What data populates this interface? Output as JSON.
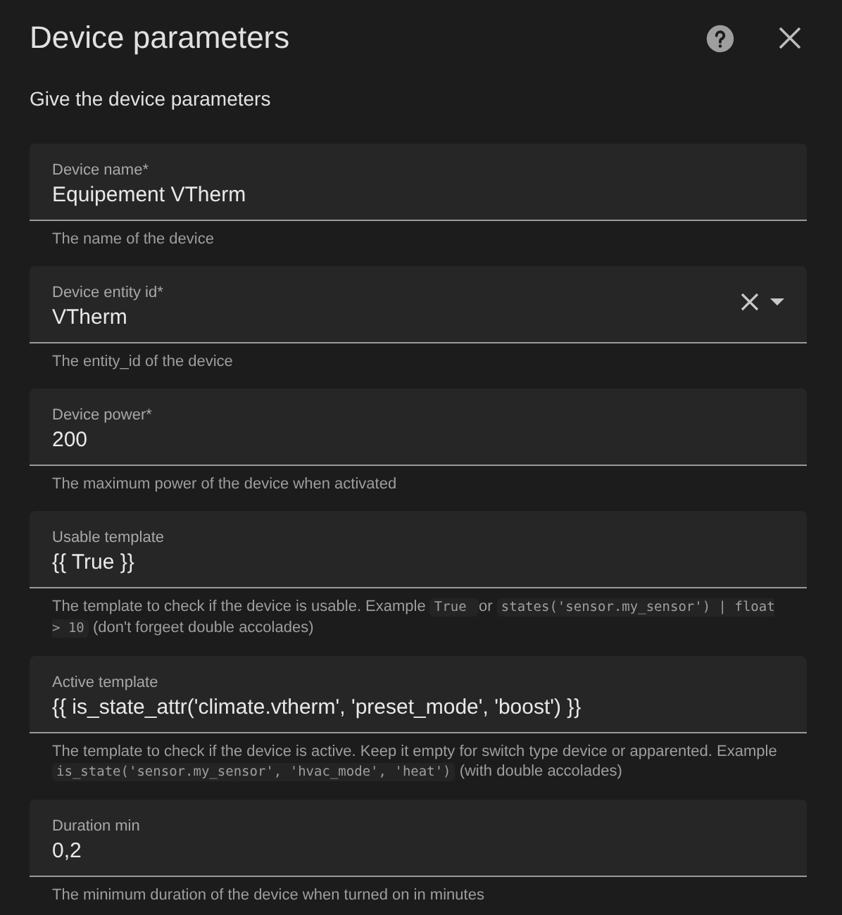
{
  "dialog": {
    "title": "Device parameters",
    "subtitle": "Give the device parameters"
  },
  "fields": [
    {
      "kind": "text",
      "label": "Device name*",
      "value": "Equipement VTherm",
      "helper": [
        {
          "kind": "text",
          "text": "The name of the device"
        }
      ]
    },
    {
      "kind": "select",
      "label": "Device entity id*",
      "value": "VTherm",
      "helper": [
        {
          "kind": "text",
          "text": "The entity_id of the device"
        }
      ]
    },
    {
      "kind": "text",
      "label": "Device power*",
      "value": "200",
      "helper": [
        {
          "kind": "text",
          "text": "The maximum power of the device when activated"
        }
      ]
    },
    {
      "kind": "text",
      "label": "Usable template",
      "value": "{{ True }}",
      "helper": [
        {
          "kind": "text",
          "text": "The template to check if the device is usable. Example "
        },
        {
          "kind": "code",
          "text": "True "
        },
        {
          "kind": "text",
          "text": " or "
        },
        {
          "kind": "code",
          "text": "states('sensor.my_sensor') | float > 10"
        },
        {
          "kind": "text",
          "text": " (don't forgeet double accolades)"
        }
      ]
    },
    {
      "kind": "text",
      "label": "Active template",
      "value": "{{ is_state_attr('climate.vtherm', 'preset_mode', 'boost') }}",
      "helper": [
        {
          "kind": "text",
          "text": "The template to check if the device is active. Keep it empty for switch type device or apparented. Example "
        },
        {
          "kind": "code",
          "text": "is_state('sensor.my_sensor', 'hvac_mode', 'heat')"
        },
        {
          "kind": "text",
          "text": " (with double accolades)"
        }
      ]
    },
    {
      "kind": "text",
      "label": "Duration min",
      "value": "0,2",
      "helper": [
        {
          "kind": "text",
          "text": "The minimum duration of the device when turned on in minutes"
        }
      ]
    }
  ]
}
